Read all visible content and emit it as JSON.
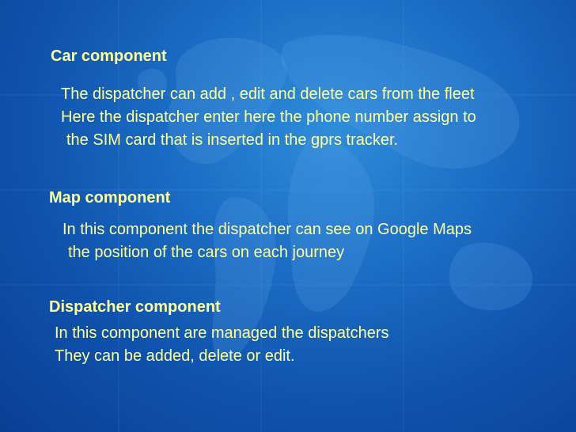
{
  "sections": [
    {
      "heading": "Car component",
      "lines": [
        "The dispatcher can add , edit and delete cars from the fleet",
        "Here the dispatcher enter here the phone number assign to",
        "the SIM card that is inserted in the gprs tracker."
      ]
    },
    {
      "heading": "Map component",
      "lines": [
        "In this component the dispatcher can see on Google Maps",
        "the position of the cars on each journey"
      ]
    },
    {
      "heading": "Dispatcher component",
      "lines": [
        "In this component are managed the dispatchers",
        "They can be added, delete or edit."
      ]
    }
  ],
  "colors": {
    "text": "#ffff99",
    "background": "#1b6cc4"
  },
  "icons": {
    "background": "world-map-background"
  }
}
